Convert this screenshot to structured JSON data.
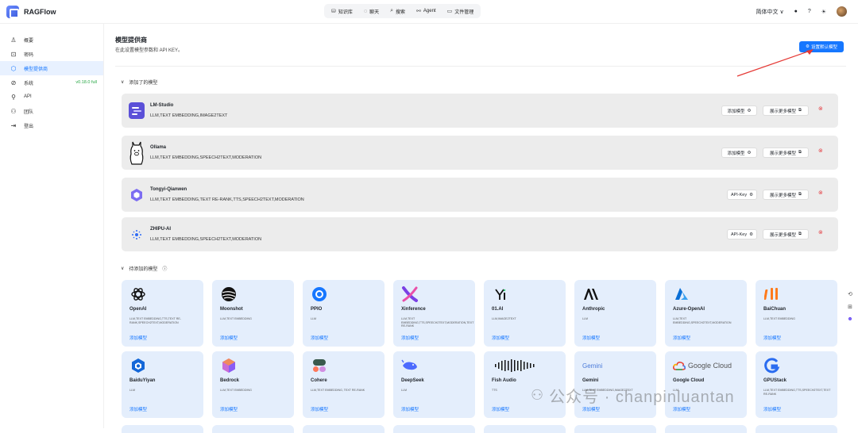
{
  "app": {
    "name": "RAGFlow"
  },
  "topnav": [
    {
      "label": "知识库",
      "icon": "database-icon"
    },
    {
      "label": "聊天",
      "icon": "chat-icon"
    },
    {
      "label": "搜索",
      "icon": "search-icon"
    },
    {
      "label": "Agent",
      "icon": "agent-icon"
    },
    {
      "label": "文件管理",
      "icon": "folder-icon"
    }
  ],
  "topright": {
    "language": "简体中文"
  },
  "sidebar": {
    "items": [
      {
        "label": "概要",
        "icon": "user-icon"
      },
      {
        "label": "密码",
        "icon": "lock-icon"
      },
      {
        "label": "模型提供商",
        "icon": "cube-icon",
        "active": true
      },
      {
        "label": "系统",
        "icon": "system-icon"
      },
      {
        "label": "API",
        "icon": "api-icon"
      },
      {
        "label": "团队",
        "icon": "team-icon"
      },
      {
        "label": "登出",
        "icon": "logout-icon"
      }
    ],
    "version": "v0.18.0 full"
  },
  "page": {
    "title": "模型提供商",
    "subtitle": "在此设置模型参数和 API KEY。",
    "set_default_label": "设置默认模型"
  },
  "added_section": {
    "label": "添加了的模型"
  },
  "added_models": [
    {
      "name": "LM-Studio",
      "tags": "LLM,TEXT EMBEDDING,IMAGE2TEXT",
      "button1": "添加模型",
      "button2": "展示更多模型",
      "icon": "lm-studio-icon"
    },
    {
      "name": "Ollama",
      "tags": "LLM,TEXT EMBEDDING,SPEECH2TEXT,MODERATION",
      "button1": "添加模型",
      "button2": "展示更多模型",
      "icon": "ollama-icon"
    },
    {
      "name": "Tongyi-Qianwen",
      "tags": "LLM,TEXT EMBEDDING,TEXT RE-RANK,TTS,SPEECH2TEXT,MODERATION",
      "button1": "API-Key",
      "button2": "展示更多模型",
      "icon": "tongyi-icon"
    },
    {
      "name": "ZHIPU-AI",
      "tags": "LLM,TEXT EMBEDDING,SPEECH2TEXT,MODERATION",
      "button1": "API-Key",
      "button2": "展示更多模型",
      "icon": "zhipu-icon"
    }
  ],
  "pending_section": {
    "label": "待添加的模型"
  },
  "pending_models": [
    {
      "name": "OpenAI",
      "tags": "LLM,TEXT EMBEDDING,TTS,TEXT RE-RANK,SPEECH2TEXT,MODERATION",
      "add": "添加模型",
      "icon": "openai-icon"
    },
    {
      "name": "Moonshot",
      "tags": "LLM,TEXT EMBEDDING",
      "add": "添加模型",
      "icon": "moonshot-icon"
    },
    {
      "name": "PPIO",
      "tags": "LLM",
      "add": "添加模型",
      "icon": "ppio-icon"
    },
    {
      "name": "Xinference",
      "tags": "LLM,TEXT EMBEDDING,TTS,SPEECH2TEXT,MODERATION,TEXT RE-RANK",
      "add": "添加模型",
      "icon": "xinference-icon"
    },
    {
      "name": "01.AI",
      "tags": "LLM,IMAGE2TEXT",
      "add": "添加模型",
      "icon": "01ai-icon"
    },
    {
      "name": "Anthropic",
      "tags": "LLM",
      "add": "添加模型",
      "icon": "anthropic-icon"
    },
    {
      "name": "Azure-OpenAI",
      "tags": "LLM,TEXT EMBEDDING,SPEECH2TEXT,MODERATION",
      "add": "添加模型",
      "icon": "azure-icon"
    },
    {
      "name": "BaiChuan",
      "tags": "LLM,TEXT EMBEDDING",
      "add": "添加模型",
      "icon": "baichuan-icon"
    },
    {
      "name": "BaiduYiyan",
      "tags": "LLM",
      "add": "添加模型",
      "icon": "baiduyiyan-icon"
    },
    {
      "name": "Bedrock",
      "tags": "LLM,TEXT EMBEDDING",
      "add": "添加模型",
      "icon": "bedrock-icon"
    },
    {
      "name": "Cohere",
      "tags": "LLM,TEXT EMBEDDING, TEXT RE-RANK",
      "add": "添加模型",
      "icon": "cohere-icon"
    },
    {
      "name": "DeepSeek",
      "tags": "LLM",
      "add": "添加模型",
      "icon": "deepseek-icon"
    },
    {
      "name": "Fish Audio",
      "tags": "TTS",
      "add": "添加模型",
      "icon": "fish-audio-icon"
    },
    {
      "name": "Gemini",
      "tags": "LLM,TEXT EMBEDDING,IMAGE2TEXT",
      "add": "添加模型",
      "icon": "gemini-icon"
    },
    {
      "name": "Google Cloud",
      "tags": "LLM",
      "add": "添加模型",
      "icon": "google-cloud-icon"
    },
    {
      "name": "GPUStack",
      "tags": "LLM,TEXT EMBEDDING,TTS,SPEECH2TEXT,TEXT RE-RANK",
      "add": "添加模型",
      "icon": "gpustack-icon"
    }
  ],
  "logos": {
    "gemini": "Gemini",
    "google_cloud": "Google Cloud"
  },
  "watermark": "公众号 · chanpinluantan"
}
